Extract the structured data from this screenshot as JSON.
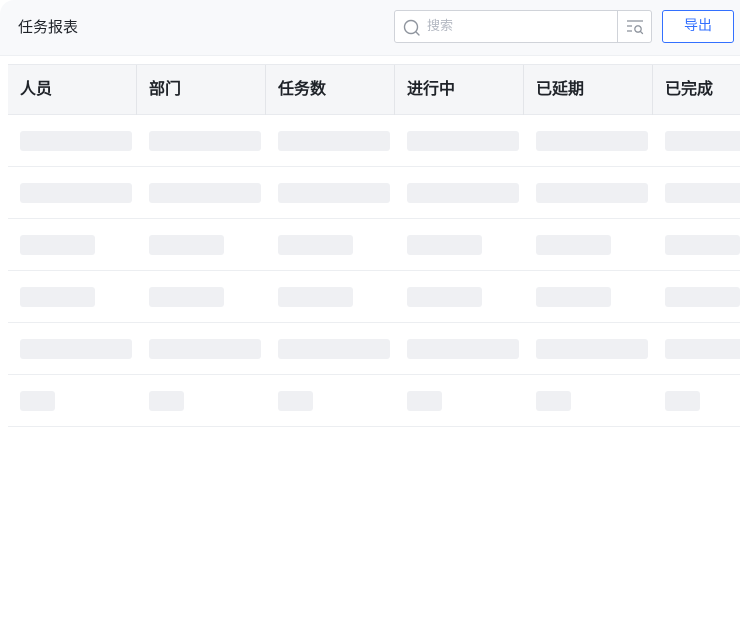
{
  "header": {
    "title": "任务报表",
    "search_placeholder": "搜索",
    "search_value": "",
    "export_label": "导出"
  },
  "icons": {
    "search": "search-icon",
    "filter": "filter-search-icon"
  },
  "colors": {
    "accent": "#3370ff",
    "skeleton": "#eff0f3",
    "header_bg": "#f5f6f8",
    "topbar_bg": "#f8f9fb"
  },
  "table": {
    "columns": [
      "人员",
      "部门",
      "任务数",
      "进行中",
      "已延期",
      "已完成"
    ],
    "state": "loading",
    "skeleton_rows": [
      {
        "fill": 0.87
      },
      {
        "fill": 0.87
      },
      {
        "fill": 0.58
      },
      {
        "fill": 0.58
      },
      {
        "fill": 0.87
      },
      {
        "fill": 0.27
      }
    ]
  }
}
